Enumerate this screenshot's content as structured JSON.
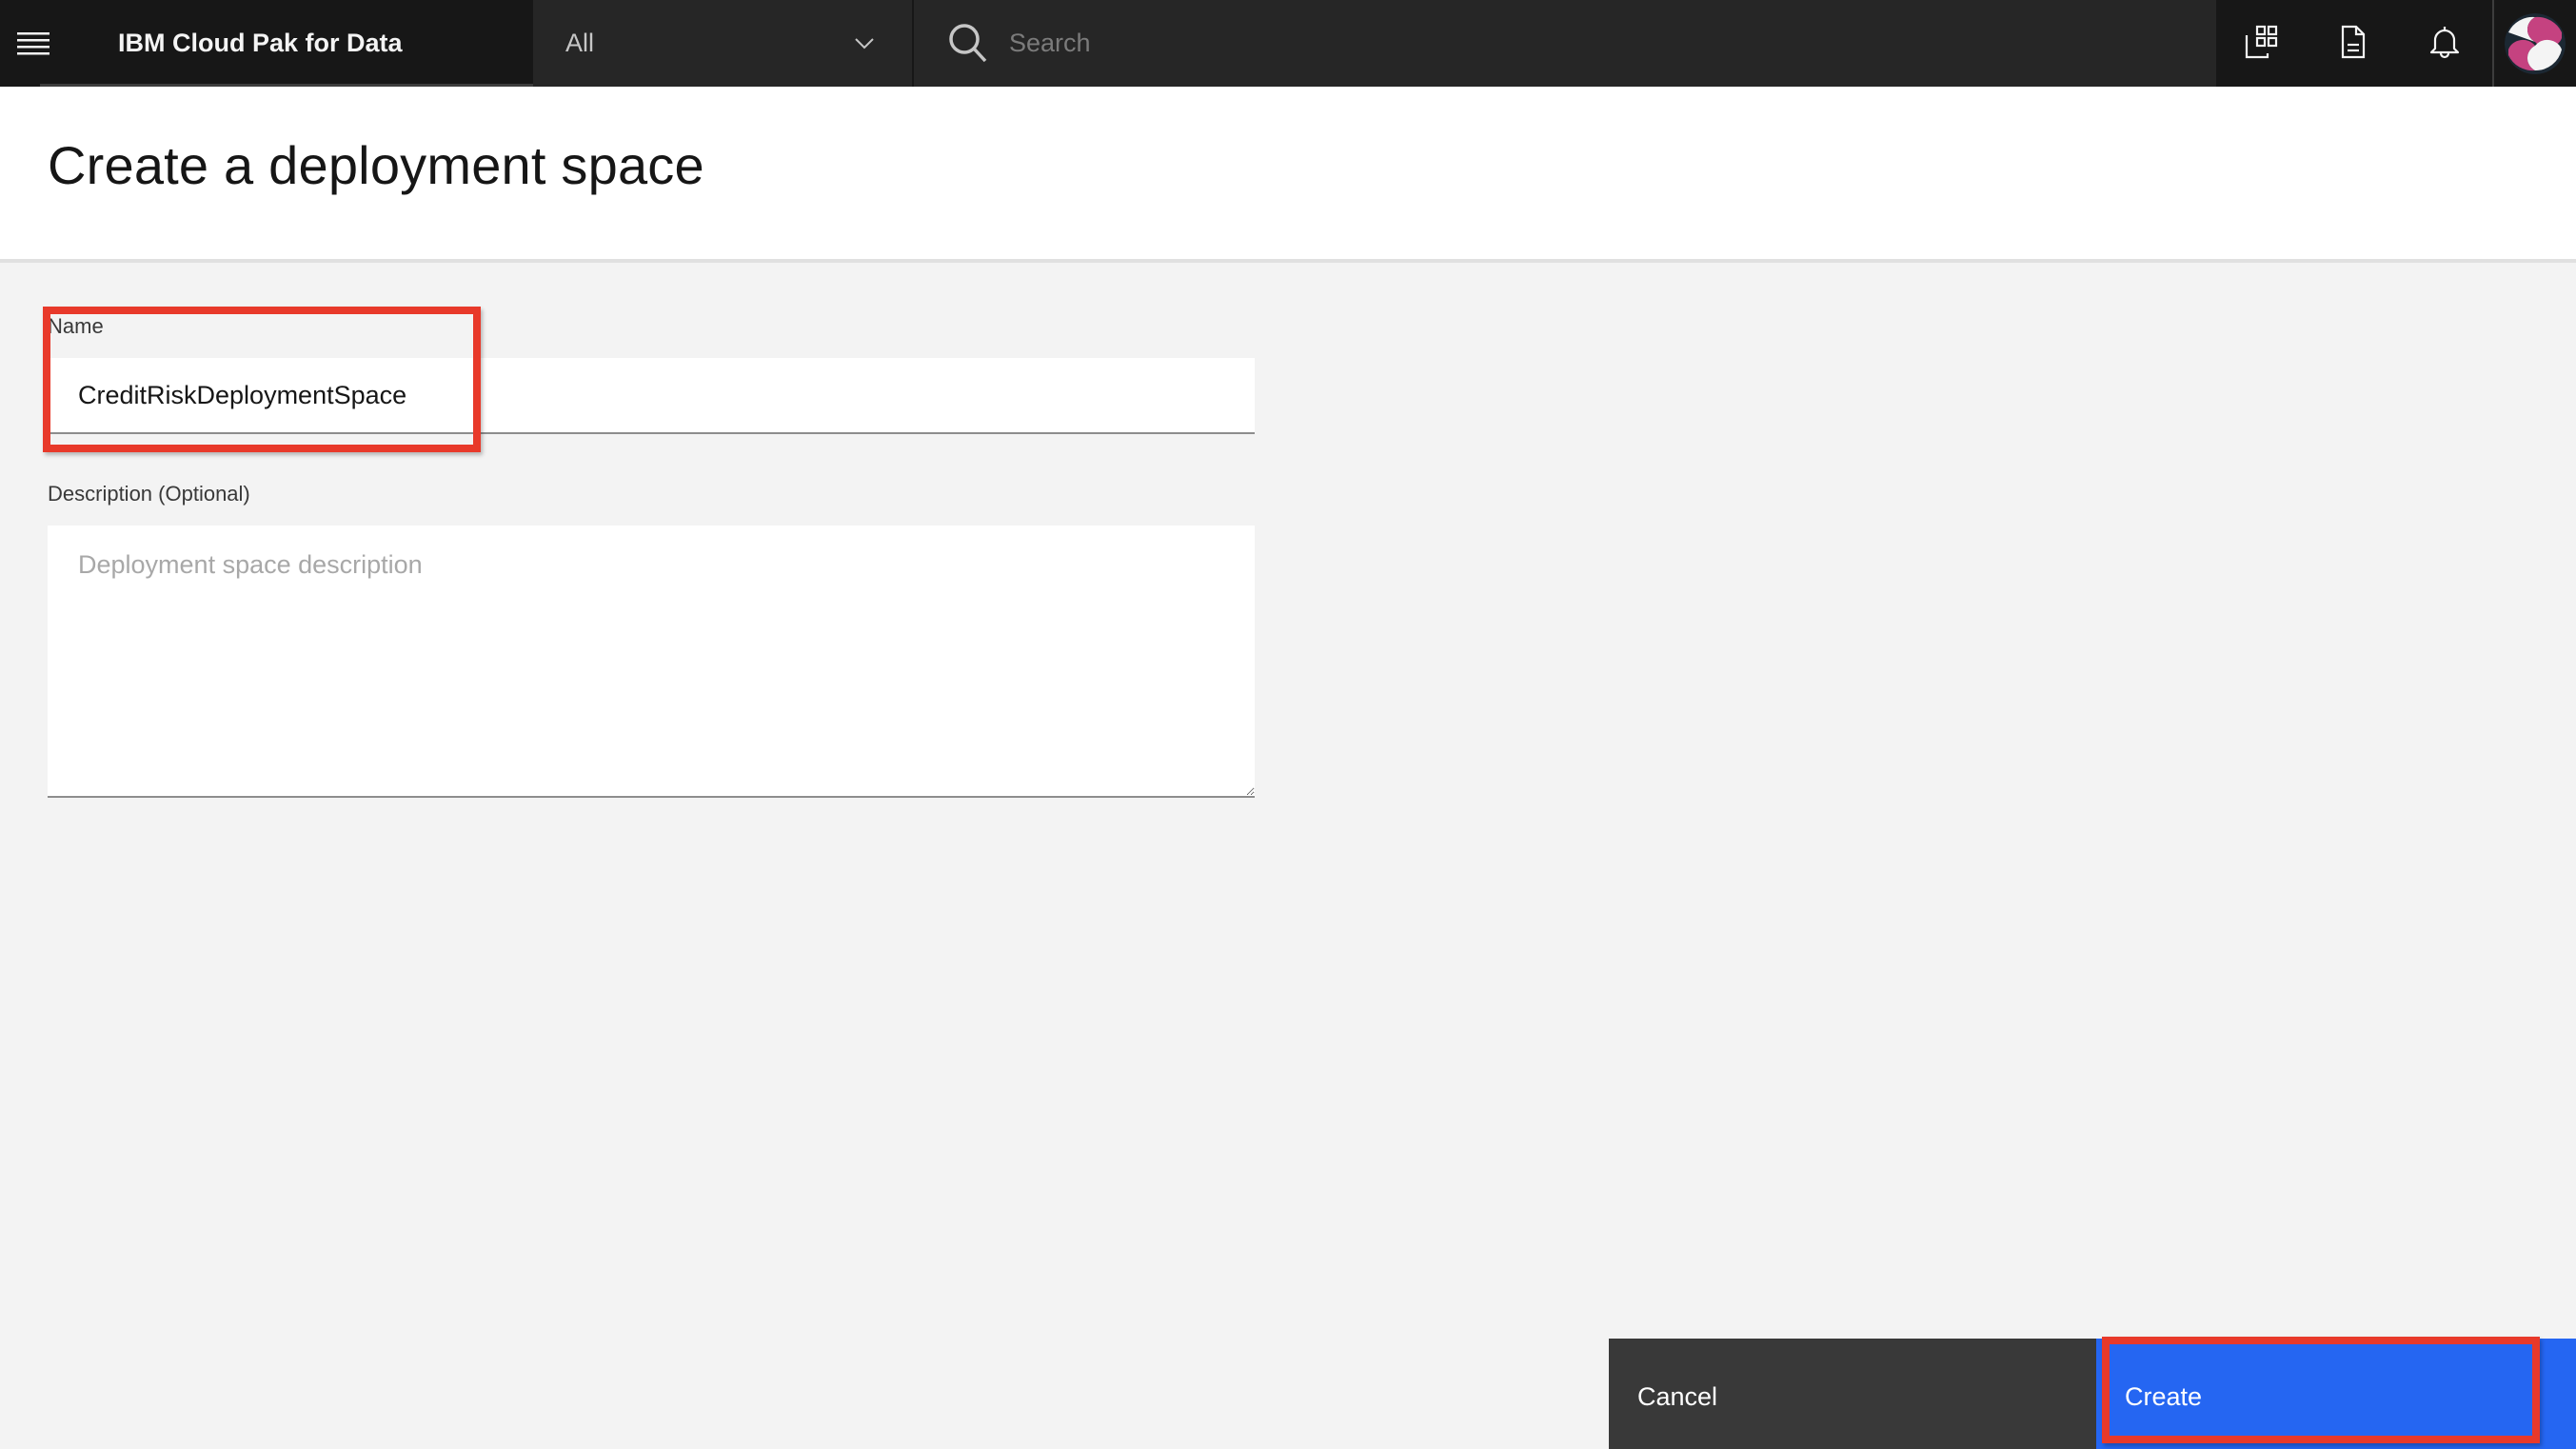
{
  "header": {
    "menu_icon": "hamburger-menu-icon",
    "brand": "IBM Cloud Pak for Data",
    "scope_select": {
      "value": "All",
      "icon": "chevron-down-icon"
    },
    "search": {
      "placeholder": "Search",
      "value": "",
      "icon": "search-icon"
    },
    "icons": [
      {
        "name": "app-switcher-icon"
      },
      {
        "name": "document-icon"
      },
      {
        "name": "notification-bell-icon"
      }
    ],
    "avatar": "user-avatar"
  },
  "page": {
    "title": "Create a deployment space"
  },
  "form": {
    "name": {
      "label": "Name",
      "value": "CreditRiskDeploymentSpace",
      "placeholder": ""
    },
    "description": {
      "label": "Description (Optional)",
      "value": "",
      "placeholder": "Deployment space description"
    }
  },
  "footer": {
    "cancel_label": "Cancel",
    "create_label": "Create"
  },
  "colors": {
    "header_bg": "#171717",
    "primary_button": "#2566f2",
    "secondary_button": "#393939",
    "annotation": "#e8392a"
  }
}
